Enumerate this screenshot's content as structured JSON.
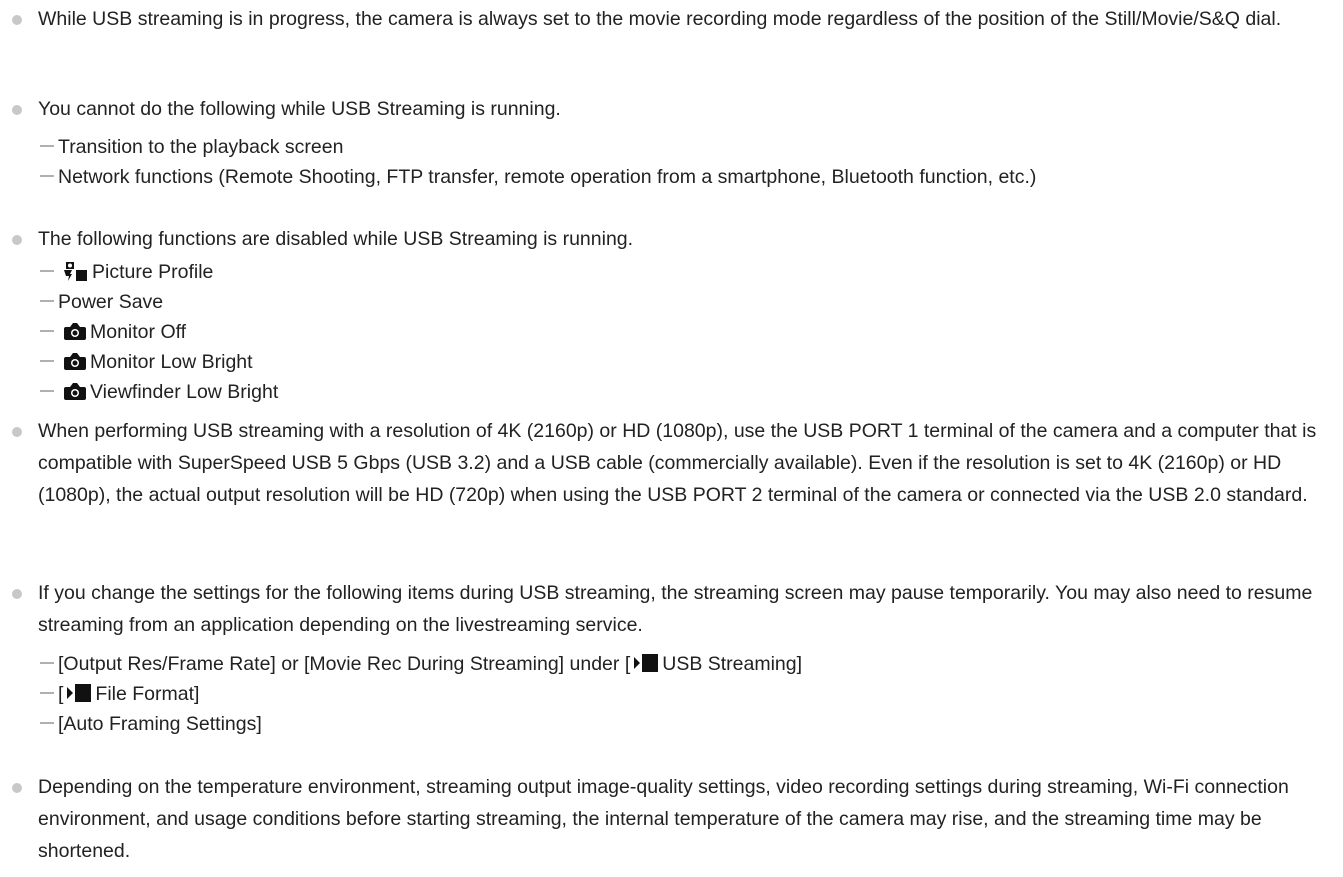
{
  "notes": [
    {
      "text": "While USB streaming is in progress, the camera is always set to the movie recording mode regardless of the position of the Still/Movie/S&Q dial."
    },
    {
      "text": "You cannot do the following while USB Streaming is running.",
      "items": [
        "Transition to the playback screen",
        "Network functions (Remote Shooting, FTP transfer, remote operation from a smartphone, Bluetooth function, etc.)"
      ]
    },
    {
      "text": "The following functions are disabled while USB Streaming is running.",
      "items": [
        "Picture Profile",
        "Power Save",
        "Monitor Off",
        "Monitor Low Bright",
        "Viewfinder Low Bright"
      ],
      "item_icons": [
        "picture-profile-icon",
        "",
        "camera-icon",
        "camera-icon",
        "camera-icon"
      ]
    },
    {
      "text": "When performing USB streaming with a resolution of 4K (2160p) or HD (1080p), use the USB PORT 1 terminal of the camera and a computer that is compatible with SuperSpeed USB 5 Gbps (USB 3.2) and a USB cable (commercially available). Even if the resolution is set to 4K (2160p) or HD (1080p), the actual output resolution will be HD (720p) when using the USB PORT 2 terminal of the camera or connected via the USB 2.0 standard."
    },
    {
      "text": "If you change the settings for the following items during USB streaming, the streaming screen may pause temporarily. You may also need to resume streaming from an application depending on the livestreaming service.",
      "items": [
        "[Output Res/Frame Rate] or [Movie Rec During Streaming] under [",
        "USB Streaming]",
        "[",
        "File Format]",
        "[Auto Framing Settings]"
      ]
    },
    {
      "text": "Depending on the temperature environment, streaming output image-quality settings, video recording settings during streaming, Wi-Fi connection environment, and usage conditions before starting streaming, the internal temperature of the camera may rise, and the streaming time may be shortened."
    }
  ],
  "colors": {
    "text": "#222222",
    "bullet": "#c8c8c8",
    "dash": "#b0b0b0",
    "icon": "#111111"
  }
}
